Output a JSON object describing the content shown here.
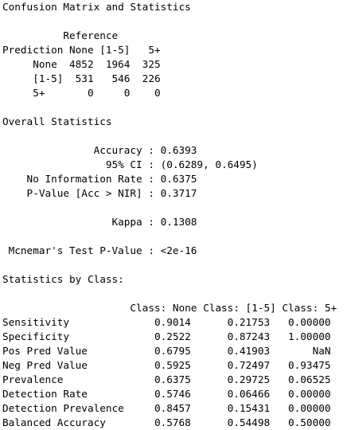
{
  "console": {
    "lines": [
      "Confusion Matrix and Statistics",
      "",
      "          Reference",
      "Prediction None [1-5]   5+",
      "     None  4852  1964  325",
      "     [1-5]  531   546  226",
      "     5+       0     0    0",
      "",
      "Overall Statistics",
      "",
      "               Accuracy : 0.6393",
      "                 95% CI : (0.6289, 0.6495)",
      "    No Information Rate : 0.6375",
      "    P-Value [Acc > NIR] : 0.3717",
      "",
      "                  Kappa : 0.1308",
      "",
      " Mcnemar's Test P-Value : <2e-16",
      "",
      "Statistics by Class:",
      "",
      "                     Class: None Class: [1-5] Class: 5+",
      "Sensitivity              0.9014      0.21753   0.00000",
      "Specificity              0.2522      0.87243   1.00000",
      "Pos Pred Value           0.6795      0.41903       NaN",
      "Neg Pred Value           0.5925      0.72497   0.93475",
      "Prevalence               0.6375      0.29725   0.06525",
      "Detection Rate           0.5746      0.06466   0.00000",
      "Detection Prevalence     0.8457      0.15431   0.00000",
      "Balanced Accuracy        0.5768      0.54498   0.50000"
    ]
  }
}
